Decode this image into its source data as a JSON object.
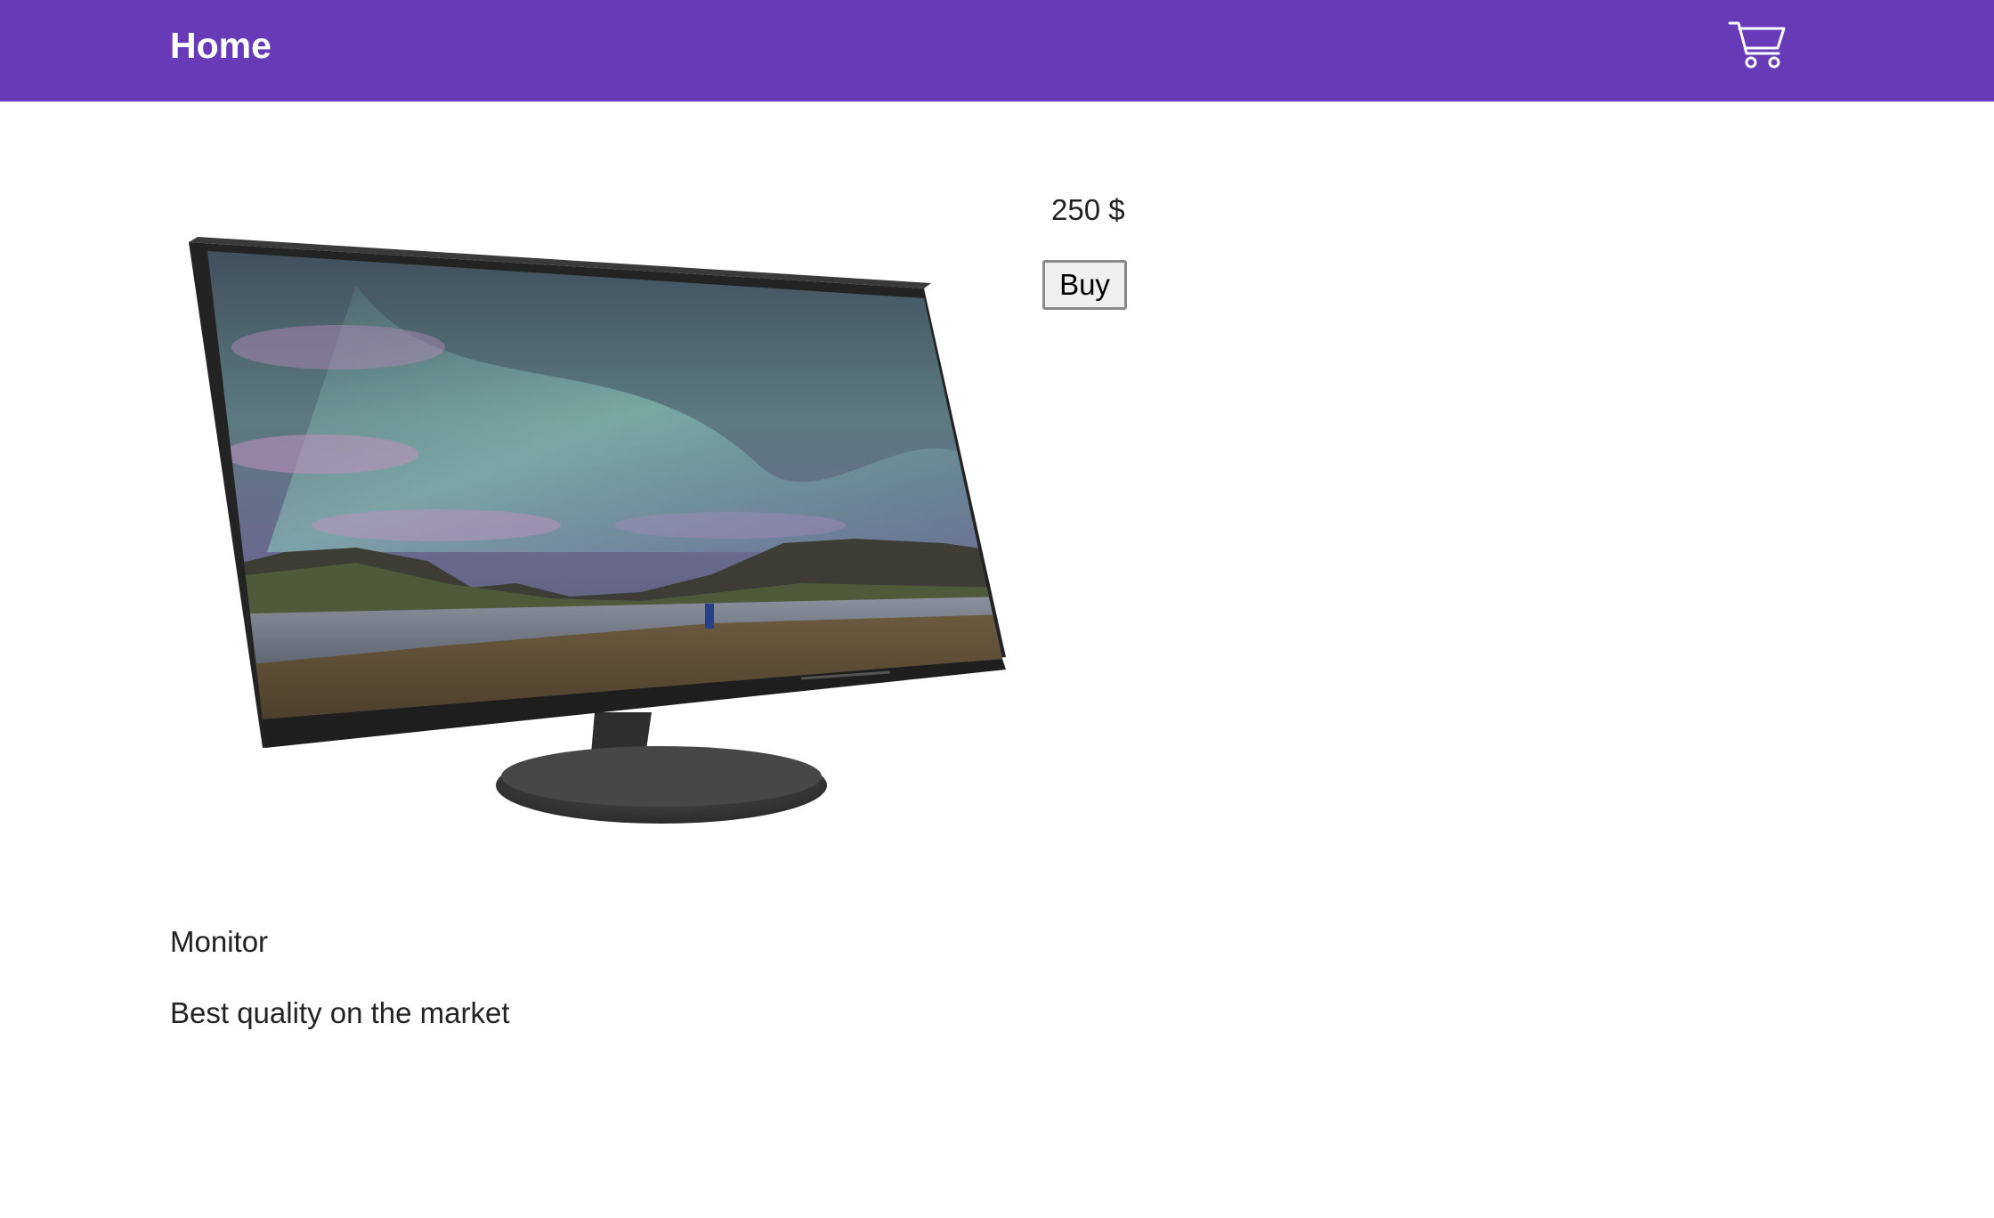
{
  "navbar": {
    "title": "Home",
    "cart_icon": "shopping-cart-icon",
    "background": "#673ab7"
  },
  "product": {
    "image_alt": "Monitor",
    "price": "250 $",
    "buy_label": "Buy",
    "name": "Monitor",
    "description": "Best quality on the market"
  }
}
